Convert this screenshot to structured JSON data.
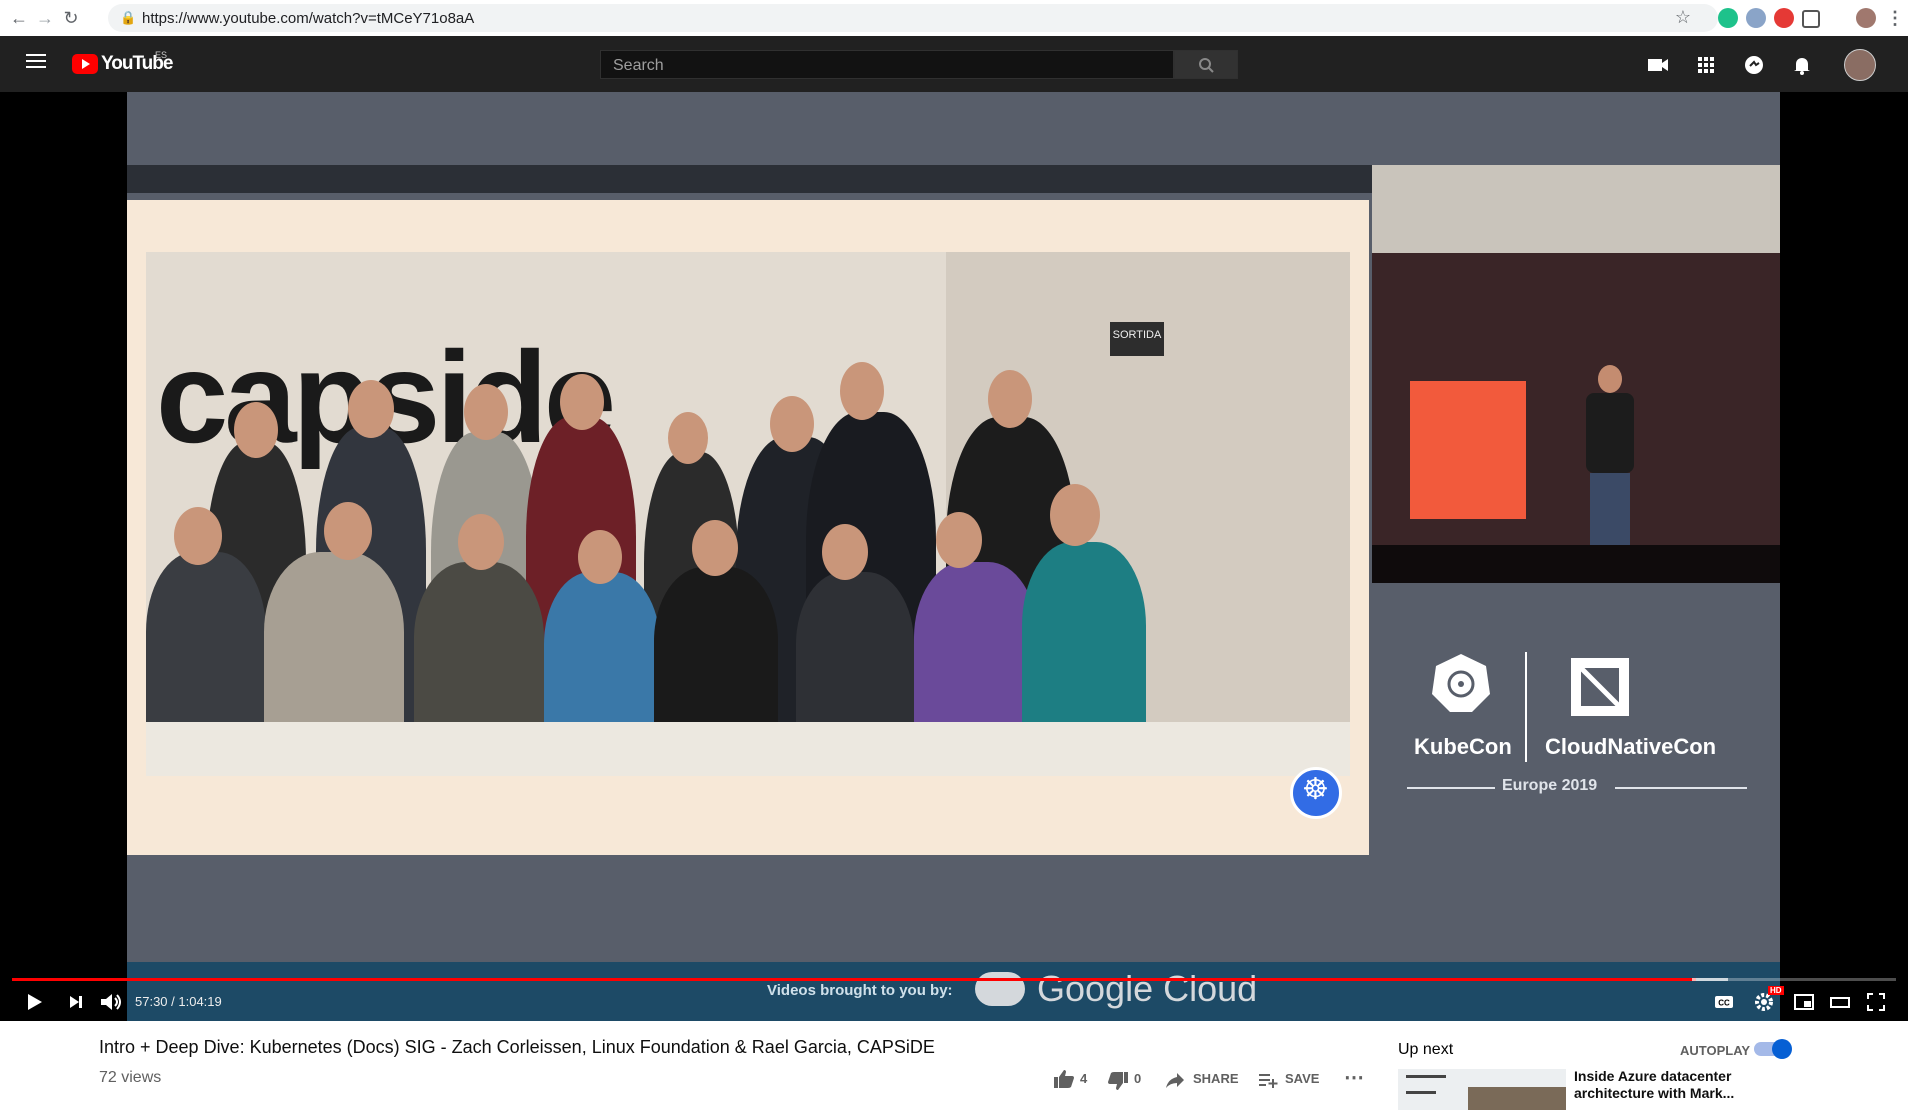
{
  "browser": {
    "url": "https://www.youtube.com/watch?v=tMCeY71o8aA",
    "icons": [
      "back-icon",
      "forward-icon",
      "reload-icon",
      "lock-icon",
      "star-icon",
      "extension-icons",
      "profile-avatar",
      "menu-icon"
    ]
  },
  "header": {
    "logo_text": "YouTube",
    "region": "ES",
    "search_placeholder": "Search",
    "icons": [
      "hamburger-icon",
      "search-icon",
      "create-video-icon",
      "apps-icon",
      "messages-icon",
      "notifications-icon",
      "avatar"
    ]
  },
  "video": {
    "slide_text": "capside",
    "sign_text": "SORTIDA",
    "event_left": "KubeCon",
    "event_right": "CloudNativeCon",
    "event_sub": "Europe 2019",
    "sponsor_prefix": "Videos brought to you by:",
    "sponsor_name": "Google Cloud",
    "current_time": "57:30",
    "duration": "1:04:19",
    "time_display": "57:30 / 1:04:19",
    "progress": 0.894,
    "quality_badge": "HD"
  },
  "info": {
    "title": "Intro + Deep Dive: Kubernetes (Docs) SIG - Zach Corleissen, Linux Foundation & Rael Garcia, CAPSiDE",
    "views": "72 views",
    "likes": "4",
    "dislikes": "0",
    "share_label": "SHARE",
    "save_label": "SAVE"
  },
  "sidebar": {
    "up_next": "Up next",
    "autoplay": "AUTOPLAY",
    "autoplay_on": true,
    "next_title": "Inside Azure datacenter architecture with Mark..."
  },
  "colors": {
    "yt_red": "#ff0000",
    "header_bg": "#212121",
    "accent_blue": "#065fd4"
  }
}
